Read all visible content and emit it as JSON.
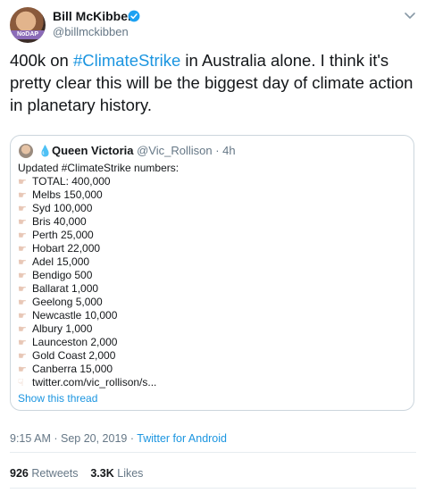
{
  "tweet": {
    "author_name": "Bill McKibben",
    "author_handle": "@billmckibben",
    "avatar_tag": "NoDAP",
    "text_before": "400k on ",
    "hashtag": "#ClimateStrike",
    "text_after": " in Australia alone. I think it's pretty clear this will be the biggest day of climate action in planetary history.",
    "time": "9:15 AM",
    "date": "Sep 20, 2019",
    "source": "Twitter for Android",
    "retweets_count": "926",
    "retweets_label": "Retweets",
    "likes_count": "3.3K",
    "likes_label": "Likes"
  },
  "quote": {
    "icon": "droplet-icon",
    "author_name": "Queen Victoria",
    "author_handle": "@Vic_Rollison",
    "time": "4h",
    "intro": "Updated #ClimateStrike numbers:",
    "lines": [
      "TOTAL: 400,000",
      "Melbs 150,000",
      "Syd 100,000",
      "Bris 40,000",
      "Perth 25,000",
      "Hobart 22,000",
      "Adel 15,000",
      "Bendigo 500",
      "Ballarat 1,000",
      "Geelong 5,000",
      "Newcastle 10,000",
      "Albury 1,000",
      "Launceston 2,000",
      "Gold Coast 2,000",
      "Canberra 15,000"
    ],
    "link": "twitter.com/vic_rollison/s...",
    "show_thread": "Show this thread"
  },
  "colors": {
    "link": "#1b95e0",
    "muted": "#657786",
    "text": "#14171a",
    "border": "#ccd6dd"
  }
}
